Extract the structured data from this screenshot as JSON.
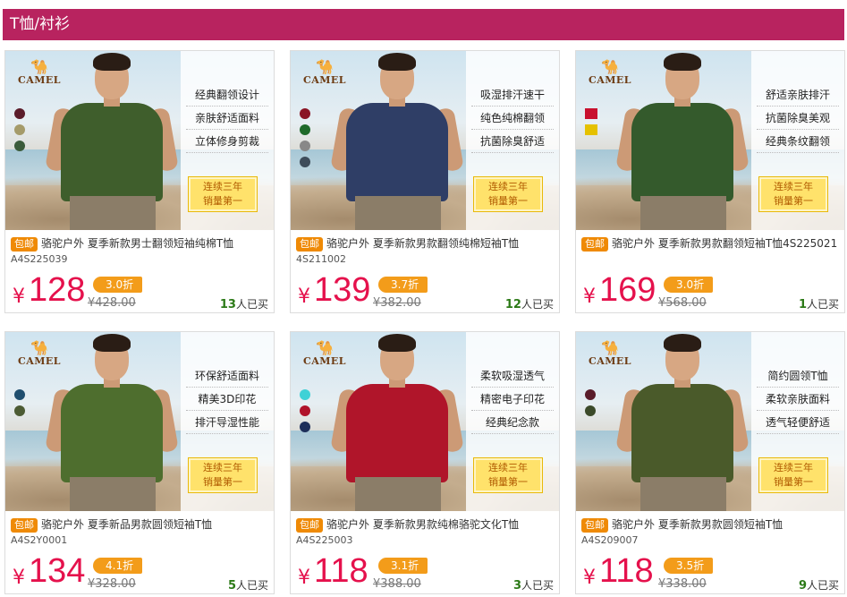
{
  "header": {
    "title": "T恤/衬衫"
  },
  "brand": {
    "name": "CAMEL"
  },
  "products": [
    {
      "swatches": [
        "#5a1c2a",
        "#a59b6a",
        "#3b5b3a"
      ],
      "shirt_color": "#3f5e2c",
      "features": [
        "经典翻领设计",
        "亲肤舒适面料",
        "立体修身剪裁"
      ],
      "badge": [
        "连续三年",
        "销量第一"
      ],
      "tag": "包邮",
      "title": "骆驼户外 夏季新款男士翻领短袖纯棉T恤",
      "sku": "A4S225039",
      "yen": "¥",
      "price": "128",
      "discount": "3.0折",
      "original": "¥428.00",
      "sold_count": "13",
      "sold_suffix": "人已买"
    },
    {
      "swatches": [
        "#8a1424",
        "#1e6a2a",
        "#888888",
        "#3e4c5a"
      ],
      "shirt_color": "#2f3e66",
      "features": [
        "吸湿排汗速干",
        "纯色纯棉翻领",
        "抗菌除臭舒适"
      ],
      "badge": [
        "连续三年",
        "销量第一"
      ],
      "tag": "包邮",
      "title": "骆驼户外 夏季新款男款翻领纯棉短袖T恤",
      "sku": "4S211002",
      "yen": "¥",
      "price": "139",
      "discount": "3.7折",
      "original": "¥382.00",
      "sold_count": "12",
      "sold_suffix": "人已买"
    },
    {
      "swatches": [
        "#c8102e",
        "#e5c100"
      ],
      "shirt_color": "#345a2c",
      "features": [
        "舒适亲肤排汗",
        "抗菌除臭美观",
        "经典条纹翻领"
      ],
      "badge": [
        "连续三年",
        "销量第一"
      ],
      "tag": "包邮",
      "title": "骆驼户外 夏季新款男款翻领短袖T恤4S225021",
      "sku": "",
      "yen": "¥",
      "price": "169",
      "discount": "3.0折",
      "original": "¥568.00",
      "sold_count": "1",
      "sold_suffix": "人已买"
    },
    {
      "swatches": [
        "#1f4e6e",
        "#4c5b34"
      ],
      "shirt_color": "#4e6e2e",
      "features": [
        "环保舒适面料",
        "精美3D印花",
        "排汗导湿性能"
      ],
      "badge": [
        "连续三年",
        "销量第一"
      ],
      "tag": "包邮",
      "title": "骆驼户外 夏季新品男款圆领短袖T恤",
      "sku": "A4S2Y0001",
      "yen": "¥",
      "price": "134",
      "discount": "4.1折",
      "original": "¥328.00",
      "sold_count": "5",
      "sold_suffix": "人已买"
    },
    {
      "swatches": [
        "#3fd1d6",
        "#b0122a",
        "#1d2f5a"
      ],
      "shirt_color": "#b0152a",
      "features": [
        "柔软吸湿透气",
        "精密电子印花",
        "经典纪念款"
      ],
      "badge": [
        "连续三年",
        "销量第一"
      ],
      "tag": "包邮",
      "title": "骆驼户外 夏季新款男款纯棉骆驼文化T恤",
      "sku": "A4S225003",
      "yen": "¥",
      "price": "118",
      "discount": "3.1折",
      "original": "¥388.00",
      "sold_count": "3",
      "sold_suffix": "人已买"
    },
    {
      "swatches": [
        "#5a1c2a",
        "#3b4a2a"
      ],
      "shirt_color": "#4a5a2a",
      "features": [
        "简约圆领T恤",
        "柔软亲肤面料",
        "透气轻便舒适"
      ],
      "badge": [
        "连续三年",
        "销量第一"
      ],
      "tag": "包邮",
      "title": "骆驼户外 夏季新款男款圆领短袖T恤",
      "sku": "A4S209007",
      "yen": "¥",
      "price": "118",
      "discount": "3.5折",
      "original": "¥338.00",
      "sold_count": "9",
      "sold_suffix": "人已买"
    }
  ]
}
